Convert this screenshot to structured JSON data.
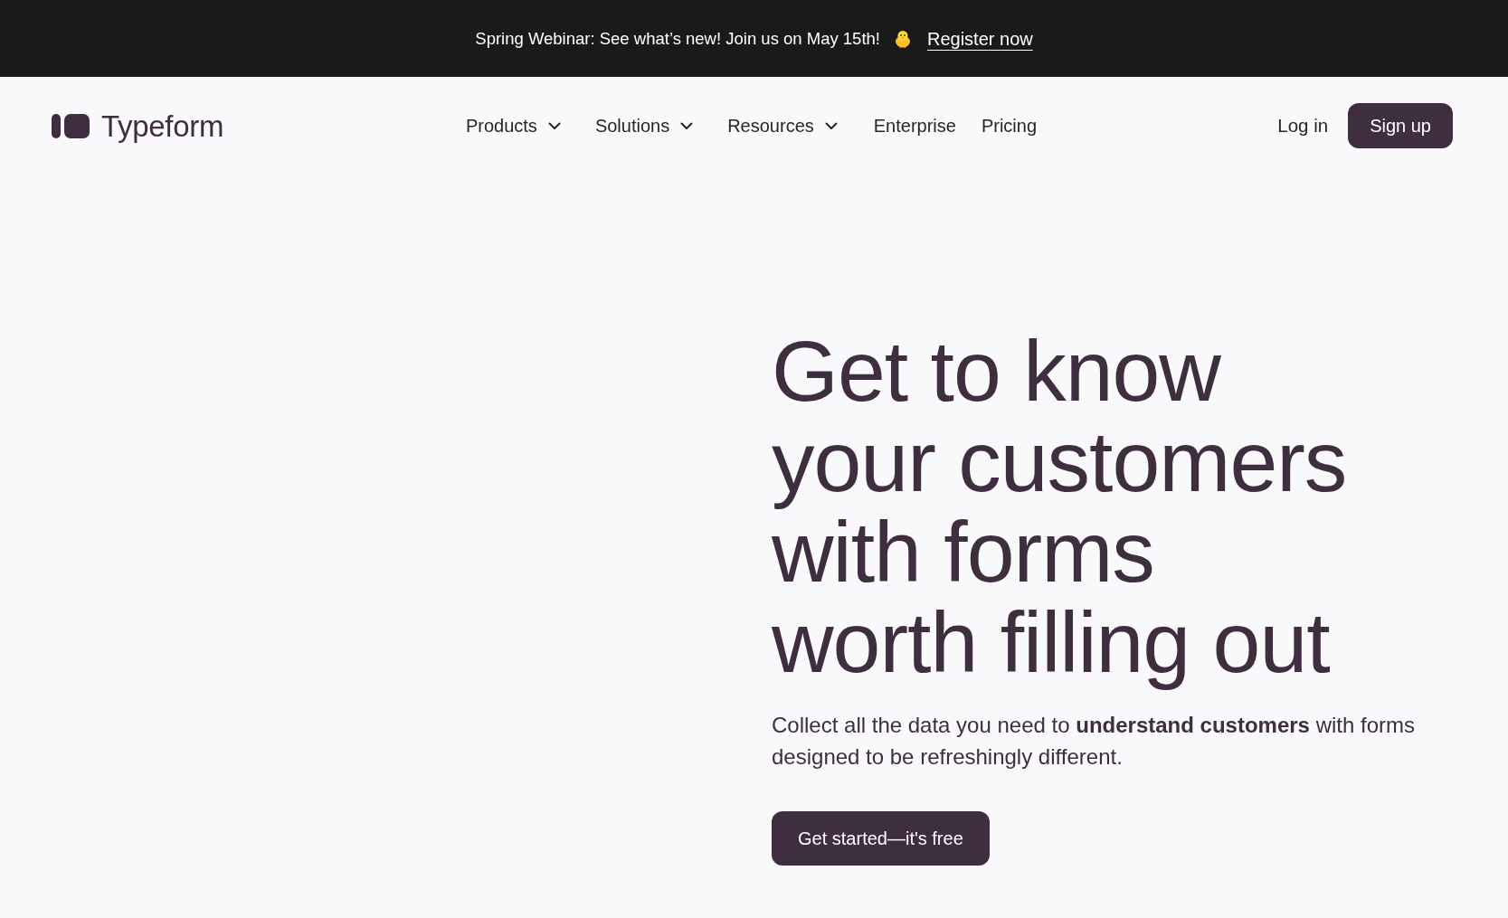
{
  "banner": {
    "message": "Spring Webinar: See what’s new! Join us on May 15th!",
    "link": "Register now"
  },
  "header": {
    "logo": "Typeform",
    "nav": [
      {
        "label": "Products",
        "dropdown": true
      },
      {
        "label": "Solutions",
        "dropdown": true
      },
      {
        "label": "Resources",
        "dropdown": true
      },
      {
        "label": "Enterprise",
        "dropdown": false
      },
      {
        "label": "Pricing",
        "dropdown": false
      }
    ],
    "login": "Log in",
    "signup": "Sign up"
  },
  "hero": {
    "heading": "Get to know your customers with forms worth filling out",
    "subheading": "Collect all the data you need to **understand customers** with forms designed to be refreshingly different.",
    "cta": "Get started—it's free"
  }
}
